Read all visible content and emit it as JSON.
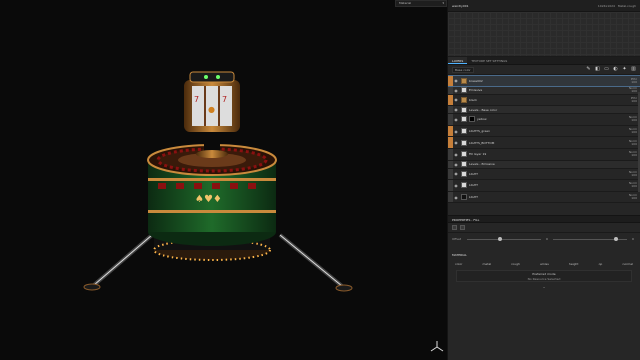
{
  "viewport": {
    "dropdown_value": "Material"
  },
  "topbar": {
    "title": "weirdly001",
    "resolution": "1024x1024",
    "mode": "Metal-rough"
  },
  "tabs": [
    {
      "label": "LAYERS",
      "active": true
    },
    {
      "label": "TEXTURE SET SETTINGS",
      "active": false
    }
  ],
  "layers_toolbar": {
    "channel": "Base color",
    "tools": [
      "paint-icon",
      "fill-icon",
      "folder-icon",
      "mask-icon",
      "effect-icon",
      "delete-icon"
    ]
  },
  "layers": [
    {
      "name": "brass002",
      "blend_mode": "Pthr",
      "opacity": "100",
      "type": "folder",
      "color_strip": "orange",
      "highlight": true
    },
    {
      "name": "Emissive",
      "blend_mode": "Norm",
      "opacity": "100",
      "type": "sub"
    },
    {
      "name": "black",
      "blend_mode": "Pthr",
      "opacity": "100",
      "type": "folder",
      "color_strip": "orange"
    },
    {
      "name": "Levels - Base color",
      "blend_mode": "",
      "opacity": "",
      "type": "sub"
    },
    {
      "name": "yellow",
      "blend_mode": "Norm",
      "opacity": "100",
      "type": "fill"
    },
    {
      "name": "LIGHTS_green",
      "blend_mode": "Norm",
      "opacity": "100",
      "type": "fill",
      "color_strip": "orange"
    },
    {
      "name": "LIGHTS_BOTTOM",
      "blend_mode": "Norm",
      "opacity": "100",
      "type": "fill",
      "color_strip": "orange"
    },
    {
      "name": "Fill layer 19",
      "blend_mode": "Norm",
      "opacity": "100",
      "type": "fill"
    },
    {
      "name": "Levels - Emissive",
      "blend_mode": "",
      "opacity": "",
      "type": "sub"
    },
    {
      "name": "LIGHT",
      "blend_mode": "Norm",
      "opacity": "100",
      "type": "fill"
    },
    {
      "name": "LIGHT",
      "blend_mode": "Norm",
      "opacity": "100",
      "type": "fill"
    },
    {
      "name": "LIGHT",
      "blend_mode": "Norm",
      "opacity": "100",
      "type": "dark"
    }
  ],
  "properties": {
    "header": "PROPERTIES - FILL",
    "offset_label": "Offset",
    "offset_values": [
      "0",
      "0"
    ],
    "offset_positions": [
      0.45,
      0.85
    ]
  },
  "material": {
    "header": "MATERIAL",
    "channels": [
      "color",
      "metal",
      "rough",
      "emiss",
      "height",
      "op",
      "normal"
    ],
    "box_title": "Preferred mode",
    "box_subtitle": "No Resource Selected",
    "more": "⌄"
  }
}
